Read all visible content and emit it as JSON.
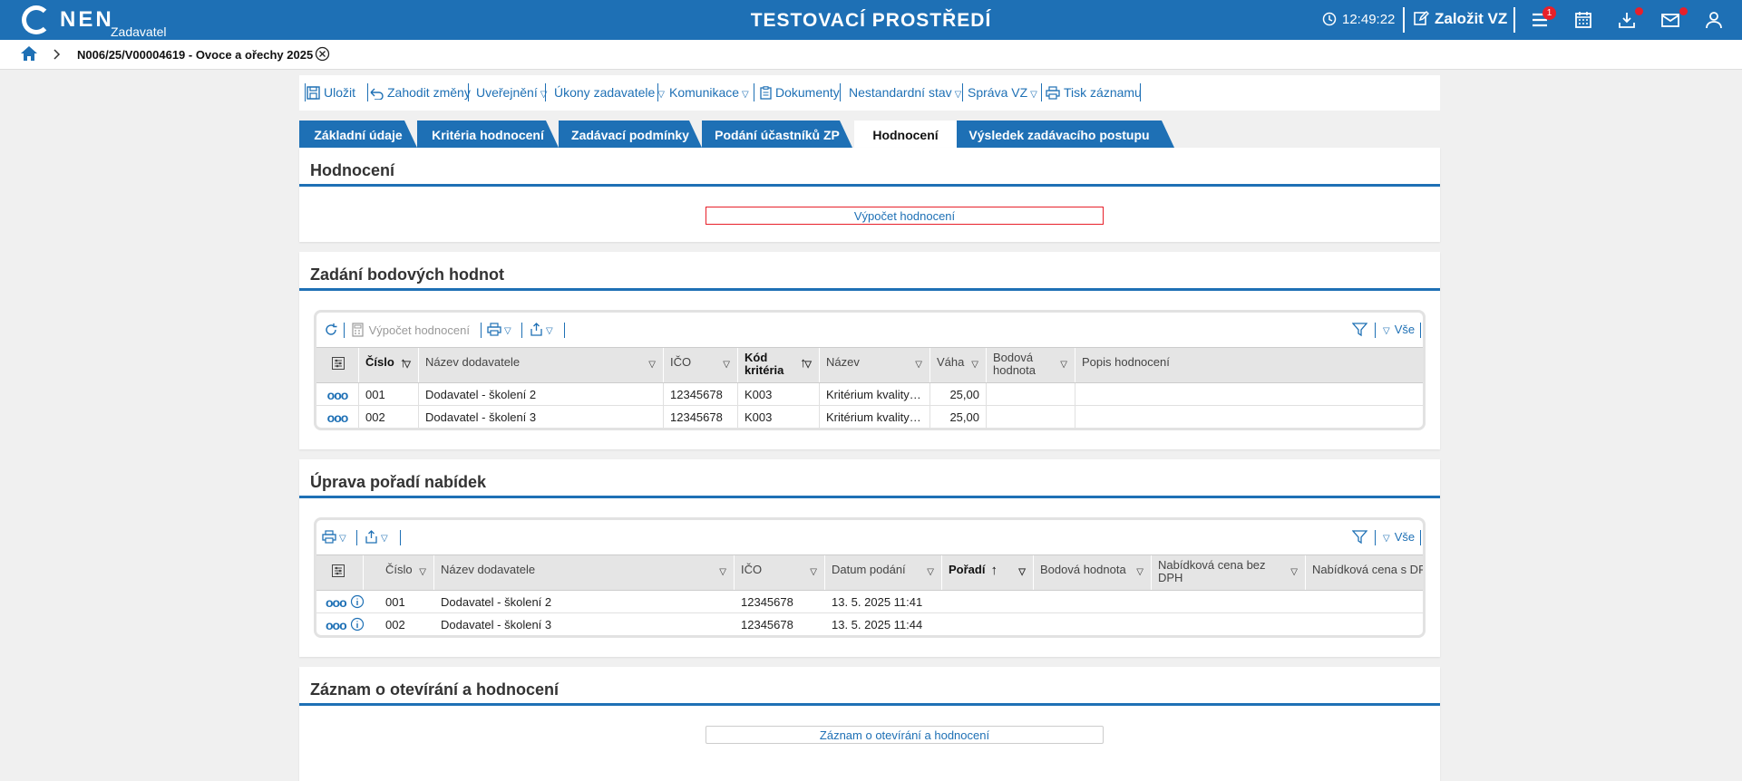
{
  "header": {
    "logo_text": "NEN",
    "logo_sub": "Zadavatel",
    "env_title": "TESTOVACÍ PROSTŘEDÍ",
    "time": "12:49:22",
    "create_label": "Založit VZ",
    "menu_badge": "1"
  },
  "breadcrumb": {
    "current": "N006/25/V00004619 - Ovoce a ořechy 2025"
  },
  "toolbar": {
    "save": "Uložit",
    "discard": "Zahodit změny",
    "publish": "Uveřejnění",
    "acts": "Úkony zadavatele",
    "comms": "Komunikace",
    "docs": "Dokumenty",
    "nonstd": "Nestandardní stav",
    "admin": "Správa VZ",
    "print": "Tisk záznamu"
  },
  "tabs": [
    {
      "label": "Základní údaje"
    },
    {
      "label": "Kritéria hodnocení"
    },
    {
      "label": "Zadávací podmínky"
    },
    {
      "label": "Podání účastníků ZP"
    },
    {
      "label": "Hodnocení"
    },
    {
      "label": "Výsledek zadávacího postupu"
    }
  ],
  "hodnoceni": {
    "title": "Hodnocení",
    "button": "Výpočet hodnocení"
  },
  "points": {
    "title": "Zadání bodových hodnot",
    "calc": "Výpočet hodnocení",
    "all": "Vše",
    "columns": [
      "Číslo",
      "Název dodavatele",
      "IČO",
      "Kód",
      "kritéria",
      "Název",
      "Váha",
      "Bodová",
      "hodnota",
      "Popis hodnocení"
    ],
    "rows": [
      {
        "cislo": "001",
        "nazev": "Dodavatel - školení 2",
        "ico": "12345678",
        "kod": "K003",
        "krit": "Kritérium kvality - org...",
        "vaha": "25,00"
      },
      {
        "cislo": "002",
        "nazev": "Dodavatel - školení 3",
        "ico": "12345678",
        "kod": "K003",
        "krit": "Kritérium kvality - org...",
        "vaha": "25,00"
      }
    ]
  },
  "order": {
    "title": "Úprava pořadí nabídek",
    "all": "Vše",
    "columns": [
      "Číslo",
      "Název dodavatele",
      "IČO",
      "Datum podání",
      "Pořadí",
      "Bodová hodnota",
      "Nabídková cena bez",
      "DPH",
      "Nabídková cena s DP"
    ],
    "rows": [
      {
        "cislo": "001",
        "nazev": "Dodavatel - školení 2",
        "ico": "12345678",
        "datum": "13. 5. 2025 11:41"
      },
      {
        "cislo": "002",
        "nazev": "Dodavatel - školení 3",
        "ico": "12345678",
        "datum": "13. 5. 2025 11:44"
      }
    ]
  },
  "record": {
    "title": "Záznam o otevírání a hodnocení",
    "button": "Záznam o otevírání a hodnocení"
  },
  "colors": {
    "accent": "#1e70b5",
    "alert": "#e8202a"
  }
}
